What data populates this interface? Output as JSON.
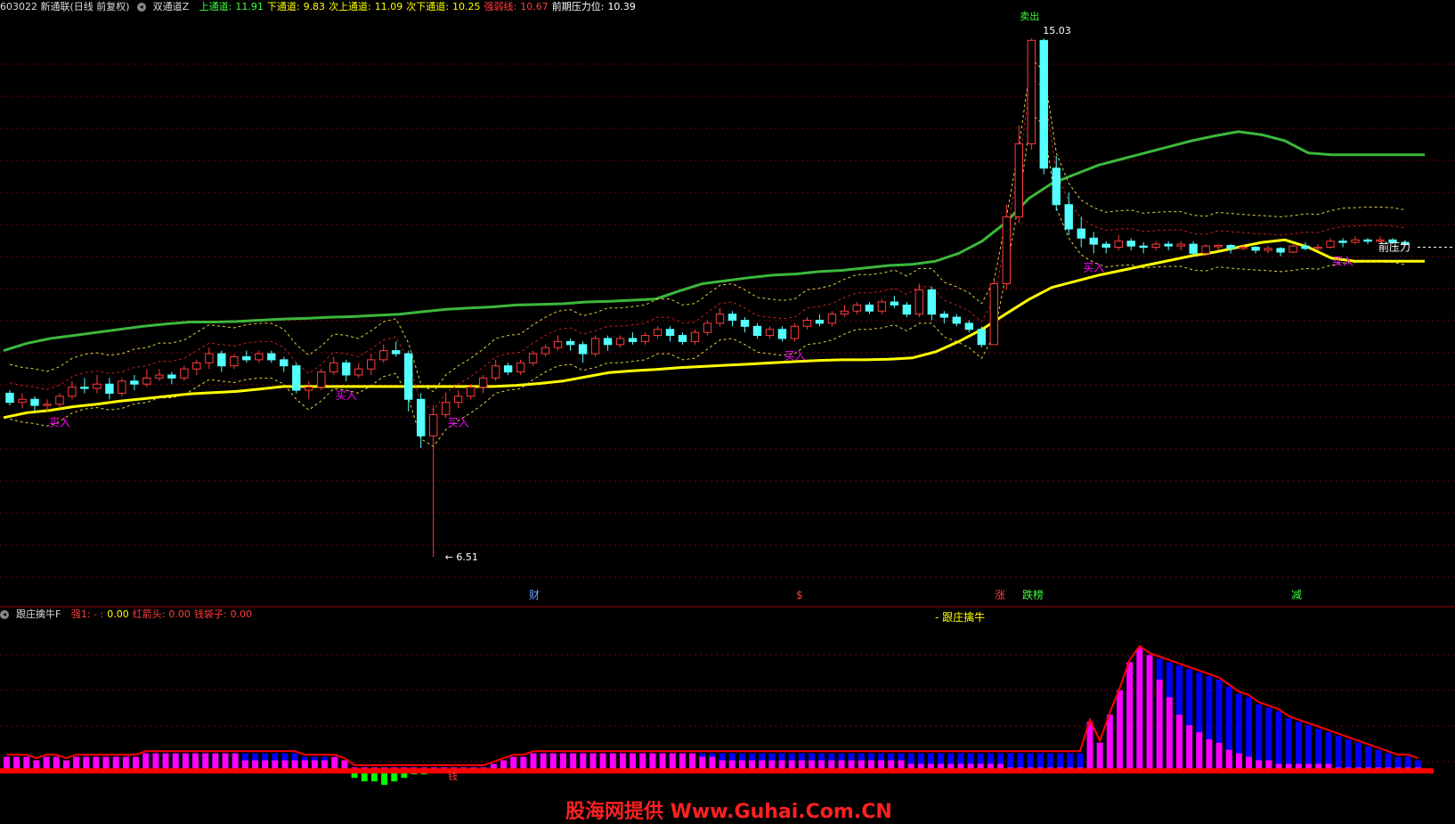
{
  "header": {
    "stock": "603022 新通联(日线 前复权)",
    "indicator": "双通道Z",
    "fields": [
      {
        "label": "上通道:",
        "value": "11.91",
        "color": "#3cff3c"
      },
      {
        "label": "下通道:",
        "value": "9.83",
        "color": "#ffff00"
      },
      {
        "label": "次上通道:",
        "value": "11.09",
        "color": "#ffff00"
      },
      {
        "label": "次下通道:",
        "value": "10.25",
        "color": "#ffff00"
      },
      {
        "label": "强弱线:",
        "value": "10.67",
        "color": "#ff3c3c"
      },
      {
        "label": "前期压力位:",
        "value": "10.39",
        "color": "#ffffff"
      }
    ]
  },
  "sub_header": {
    "indicator": "跟庄擒牛F",
    "fields": [
      {
        "label": "强1: - :",
        "value": "0.00",
        "label_color": "#ff3c3c",
        "value_color": "#ffff00"
      },
      {
        "label": "红箭头:",
        "value": "0.00",
        "label_color": "#ff3c3c",
        "value_color": "#ff3c3c"
      },
      {
        "label": "钱袋子:",
        "value": "0.00",
        "label_color": "#ff3c3c",
        "value_color": "#ff3c3c"
      }
    ]
  },
  "annotations": {
    "high_price": "15.03",
    "low_price": "6.51",
    "buy_label": "买入",
    "sell_label": "卖出",
    "pressure_label": "前压力",
    "sub_label": "跟庄擒牛",
    "money_label": "钱",
    "event_markers": [
      "财",
      "$",
      "涨",
      "跌榜",
      "减"
    ]
  },
  "watermark": "股海网提供 Www.Guhai.Com.CN",
  "colors": {
    "up": "#ff3c3c",
    "down": "#54ffff",
    "upper_channel": "#3cb83c",
    "lower_channel": "#ffff00",
    "strength": "#ff3c3c",
    "pressure": "#ffffff",
    "sub_magenta": "#ff00ff",
    "sub_blue": "#0000ff",
    "sub_red": "#ff0000",
    "sub_green": "#00ff00",
    "grid": "#800000",
    "buy_text": "#ff00ff"
  },
  "chart_data": {
    "type": "candlestick",
    "ylim": [
      6.0,
      15.4
    ],
    "candles": [
      [
        9.2,
        9.05,
        9.25,
        9.0
      ],
      [
        9.05,
        9.1,
        9.2,
        8.95
      ],
      [
        9.1,
        9.0,
        9.15,
        8.9
      ],
      [
        9.0,
        9.02,
        9.1,
        8.9
      ],
      [
        9.02,
        9.15,
        9.2,
        8.95
      ],
      [
        9.15,
        9.3,
        9.4,
        9.1
      ],
      [
        9.3,
        9.28,
        9.45,
        9.2
      ],
      [
        9.28,
        9.35,
        9.5,
        9.2
      ],
      [
        9.35,
        9.2,
        9.45,
        9.1
      ],
      [
        9.2,
        9.4,
        9.45,
        9.15
      ],
      [
        9.4,
        9.35,
        9.5,
        9.25
      ],
      [
        9.35,
        9.45,
        9.6,
        9.3
      ],
      [
        9.45,
        9.5,
        9.6,
        9.4
      ],
      [
        9.5,
        9.45,
        9.55,
        9.35
      ],
      [
        9.45,
        9.6,
        9.65,
        9.4
      ],
      [
        9.6,
        9.7,
        9.75,
        9.5
      ],
      [
        9.7,
        9.85,
        9.95,
        9.6
      ],
      [
        9.85,
        9.65,
        9.9,
        9.55
      ],
      [
        9.65,
        9.8,
        9.85,
        9.6
      ],
      [
        9.8,
        9.75,
        9.9,
        9.7
      ],
      [
        9.75,
        9.85,
        9.9,
        9.7
      ],
      [
        9.85,
        9.75,
        9.9,
        9.7
      ],
      [
        9.75,
        9.65,
        9.8,
        9.55
      ],
      [
        9.65,
        9.25,
        9.7,
        9.2
      ],
      [
        9.25,
        9.3,
        9.4,
        9.1
      ],
      [
        9.3,
        9.55,
        9.6,
        9.25
      ],
      [
        9.55,
        9.7,
        9.8,
        9.5
      ],
      [
        9.7,
        9.5,
        9.75,
        9.4
      ],
      [
        9.5,
        9.6,
        9.7,
        9.45
      ],
      [
        9.6,
        9.75,
        9.85,
        9.5
      ],
      [
        9.75,
        9.9,
        10.0,
        9.7
      ],
      [
        9.9,
        9.85,
        10.05,
        9.8
      ],
      [
        9.85,
        9.1,
        9.9,
        8.9
      ],
      [
        9.1,
        8.5,
        9.2,
        8.3
      ],
      [
        8.5,
        8.85,
        9.0,
        6.51
      ],
      [
        8.85,
        9.05,
        9.2,
        8.8
      ],
      [
        9.05,
        9.15,
        9.25,
        8.95
      ],
      [
        9.15,
        9.3,
        9.35,
        9.1
      ],
      [
        9.3,
        9.45,
        9.5,
        9.2
      ],
      [
        9.45,
        9.65,
        9.75,
        9.4
      ],
      [
        9.65,
        9.55,
        9.7,
        9.5
      ],
      [
        9.55,
        9.7,
        9.75,
        9.5
      ],
      [
        9.7,
        9.85,
        9.9,
        9.65
      ],
      [
        9.85,
        9.95,
        10.0,
        9.8
      ],
      [
        9.95,
        10.05,
        10.15,
        9.9
      ],
      [
        10.05,
        10.0,
        10.1,
        9.9
      ],
      [
        10.0,
        9.85,
        10.05,
        9.7
      ],
      [
        9.85,
        10.1,
        10.15,
        9.8
      ],
      [
        10.1,
        10.0,
        10.15,
        9.9
      ],
      [
        10.0,
        10.1,
        10.15,
        9.95
      ],
      [
        10.1,
        10.05,
        10.2,
        10.0
      ],
      [
        10.05,
        10.15,
        10.2,
        10.0
      ],
      [
        10.15,
        10.25,
        10.3,
        10.1
      ],
      [
        10.25,
        10.15,
        10.3,
        10.05
      ],
      [
        10.15,
        10.05,
        10.2,
        10.0
      ],
      [
        10.05,
        10.2,
        10.25,
        10.0
      ],
      [
        10.2,
        10.35,
        10.4,
        10.15
      ],
      [
        10.35,
        10.5,
        10.6,
        10.3
      ],
      [
        10.5,
        10.4,
        10.55,
        10.3
      ],
      [
        10.4,
        10.3,
        10.45,
        10.2
      ],
      [
        10.3,
        10.15,
        10.35,
        10.1
      ],
      [
        10.15,
        10.25,
        10.3,
        10.1
      ],
      [
        10.25,
        10.1,
        10.3,
        10.05
      ],
      [
        10.1,
        10.3,
        10.35,
        10.05
      ],
      [
        10.3,
        10.4,
        10.45,
        10.25
      ],
      [
        10.4,
        10.35,
        10.5,
        10.3
      ],
      [
        10.35,
        10.5,
        10.55,
        10.3
      ],
      [
        10.5,
        10.55,
        10.65,
        10.45
      ],
      [
        10.55,
        10.65,
        10.7,
        10.5
      ],
      [
        10.65,
        10.55,
        10.7,
        10.5
      ],
      [
        10.55,
        10.7,
        10.75,
        10.5
      ],
      [
        10.7,
        10.65,
        10.8,
        10.6
      ],
      [
        10.65,
        10.5,
        10.7,
        10.45
      ],
      [
        10.5,
        10.9,
        11.0,
        10.45
      ],
      [
        10.9,
        10.5,
        10.95,
        10.4
      ],
      [
        10.5,
        10.45,
        10.55,
        10.35
      ],
      [
        10.45,
        10.35,
        10.5,
        10.3
      ],
      [
        10.35,
        10.25,
        10.4,
        10.2
      ],
      [
        10.25,
        10.0,
        10.3,
        9.95
      ],
      [
        10.0,
        11.0,
        11.05,
        10.0
      ],
      [
        11.0,
        12.1,
        12.3,
        10.9
      ],
      [
        12.1,
        13.3,
        13.6,
        12.0
      ],
      [
        13.3,
        15.0,
        15.03,
        13.2
      ],
      [
        15.0,
        12.9,
        15.03,
        12.8
      ],
      [
        12.9,
        12.3,
        13.1,
        12.2
      ],
      [
        12.3,
        11.9,
        12.5,
        11.8
      ],
      [
        11.9,
        11.75,
        12.1,
        11.6
      ],
      [
        11.75,
        11.65,
        11.85,
        11.5
      ],
      [
        11.65,
        11.6,
        11.7,
        11.5
      ],
      [
        11.6,
        11.7,
        11.8,
        11.55
      ],
      [
        11.7,
        11.62,
        11.75,
        11.55
      ],
      [
        11.62,
        11.6,
        11.68,
        11.5
      ],
      [
        11.6,
        11.65,
        11.7,
        11.55
      ],
      [
        11.65,
        11.62,
        11.7,
        11.55
      ],
      [
        11.62,
        11.65,
        11.7,
        11.55
      ],
      [
        11.65,
        11.5,
        11.7,
        11.45
      ],
      [
        11.5,
        11.62,
        11.65,
        11.45
      ],
      [
        11.62,
        11.63,
        11.65,
        11.55
      ],
      [
        11.63,
        11.58,
        11.65,
        11.5
      ],
      [
        11.58,
        11.6,
        11.65,
        11.55
      ],
      [
        11.6,
        11.55,
        11.62,
        11.5
      ],
      [
        11.55,
        11.58,
        11.62,
        11.5
      ],
      [
        11.58,
        11.52,
        11.6,
        11.45
      ],
      [
        11.52,
        11.62,
        11.65,
        11.5
      ],
      [
        11.62,
        11.58,
        11.68,
        11.55
      ],
      [
        11.58,
        11.6,
        11.65,
        11.55
      ],
      [
        11.6,
        11.7,
        11.75,
        11.58
      ],
      [
        11.7,
        11.68,
        11.75,
        11.6
      ],
      [
        11.68,
        11.72,
        11.78,
        11.65
      ],
      [
        11.72,
        11.7,
        11.75,
        11.65
      ],
      [
        11.7,
        11.72,
        11.78,
        11.68
      ],
      [
        11.72,
        11.68,
        11.75,
        11.65
      ],
      [
        11.68,
        11.65,
        11.72,
        11.62
      ]
    ],
    "upper_channel": [
      9.9,
      10.02,
      10.1,
      10.15,
      10.2,
      10.25,
      10.3,
      10.34,
      10.37,
      10.37,
      10.38,
      10.4,
      10.42,
      10.43,
      10.45,
      10.46,
      10.48,
      10.5,
      10.54,
      10.58,
      10.6,
      10.62,
      10.65,
      10.66,
      10.67,
      10.7,
      10.71,
      10.73,
      10.75,
      10.88,
      11.0,
      11.05,
      11.1,
      11.14,
      11.16,
      11.2,
      11.22,
      11.26,
      11.3,
      11.32,
      11.37,
      11.5,
      11.7,
      12.0,
      12.4,
      12.65,
      12.8,
      12.95,
      13.05,
      13.15,
      13.25,
      13.35,
      13.43,
      13.5,
      13.45,
      13.35,
      13.15,
      13.12,
      13.12,
      13.12,
      13.12,
      13.12
    ],
    "lower_channel": [
      8.8,
      8.88,
      8.92,
      8.98,
      9.02,
      9.07,
      9.11,
      9.15,
      9.19,
      9.21,
      9.23,
      9.27,
      9.31,
      9.31,
      9.31,
      9.31,
      9.31,
      9.31,
      9.31,
      9.31,
      9.31,
      9.31,
      9.33,
      9.36,
      9.4,
      9.47,
      9.54,
      9.57,
      9.59,
      9.62,
      9.64,
      9.66,
      9.68,
      9.7,
      9.72,
      9.74,
      9.75,
      9.75,
      9.76,
      9.78,
      9.88,
      10.05,
      10.25,
      10.5,
      10.74,
      10.94,
      11.04,
      11.14,
      11.22,
      11.3,
      11.38,
      11.46,
      11.52,
      11.6,
      11.68,
      11.72,
      11.6,
      11.42,
      11.37,
      11.37,
      11.37,
      11.37
    ],
    "pressure_level": 11.6,
    "sub_chart": {
      "ylim": [
        -5,
        42
      ],
      "magenta": [
        4,
        4,
        4,
        3,
        4,
        4,
        3,
        4,
        4,
        4,
        4,
        4,
        4,
        4,
        5,
        5,
        5,
        5,
        5,
        5,
        5,
        5,
        5,
        5,
        3,
        3,
        3,
        3,
        3,
        3,
        3,
        3,
        3,
        4,
        3,
        1,
        1,
        1,
        1,
        1,
        1,
        1,
        1,
        1,
        1,
        1,
        1,
        1,
        1,
        2,
        3,
        4,
        4,
        5,
        5,
        5,
        5,
        5,
        5,
        5,
        5,
        5,
        5,
        5,
        5,
        5,
        5,
        5,
        5,
        5,
        4,
        4,
        3,
        3,
        3,
        3,
        3,
        3,
        3,
        3,
        3,
        3,
        3,
        3,
        3,
        3,
        3,
        3,
        3,
        3,
        3,
        2,
        2,
        2,
        2,
        2,
        2,
        2,
        2,
        2,
        2,
        1,
        1,
        1,
        1,
        1,
        1,
        1,
        1,
        14,
        8,
        16,
        23,
        31,
        35,
        33,
        26,
        21,
        16,
        13,
        11,
        9,
        8,
        6,
        5,
        4,
        3,
        3,
        2,
        2,
        2,
        2,
        2,
        2,
        1,
        1,
        1,
        1,
        1,
        1,
        1,
        1,
        1
      ],
      "blue": [
        4,
        4,
        4,
        3,
        4,
        4,
        3,
        4,
        4,
        4,
        4,
        4,
        4,
        4,
        5,
        5,
        5,
        5,
        5,
        5,
        5,
        5,
        5,
        5,
        5,
        5,
        5,
        5,
        5,
        5,
        4,
        4,
        4,
        4,
        3,
        1,
        1,
        1,
        1,
        1,
        1,
        1,
        1,
        1,
        1,
        1,
        1,
        1,
        1,
        2,
        3,
        4,
        4,
        5,
        5,
        5,
        5,
        5,
        5,
        5,
        5,
        5,
        5,
        5,
        5,
        5,
        5,
        5,
        5,
        5,
        5,
        5,
        5,
        5,
        5,
        5,
        5,
        5,
        5,
        5,
        5,
        5,
        5,
        5,
        5,
        5,
        5,
        5,
        5,
        5,
        5,
        5,
        5,
        5,
        5,
        5,
        5,
        5,
        5,
        5,
        5,
        5,
        5,
        5,
        5,
        5,
        5,
        5,
        5,
        14,
        8,
        16,
        23,
        31,
        35,
        33,
        32,
        31,
        30,
        29,
        28,
        27,
        26,
        24,
        22,
        21,
        19,
        18,
        17,
        15,
        14,
        13,
        12,
        11,
        10,
        9,
        8,
        7,
        6,
        5,
        4,
        4,
        3
      ],
      "green": [
        0,
        0,
        0,
        0,
        0,
        0,
        0,
        0,
        0,
        0,
        0,
        0,
        0,
        0,
        0,
        0,
        0,
        0,
        0,
        0,
        0,
        0,
        0,
        0,
        0,
        0,
        0,
        0,
        0,
        0,
        0,
        0,
        0,
        0,
        0,
        -2,
        -3,
        -3,
        -4,
        -3,
        -2,
        -1,
        -1,
        0,
        0,
        0,
        0,
        0,
        0,
        0,
        0,
        0,
        0,
        0,
        0,
        0,
        0,
        0,
        0,
        0,
        0,
        0,
        0,
        0,
        0,
        0,
        0,
        0,
        0,
        0,
        0,
        0,
        0,
        0,
        0,
        0,
        0,
        0,
        0,
        0,
        0,
        0,
        0,
        0,
        0,
        0,
        0,
        0,
        0,
        0,
        0,
        0,
        0,
        0,
        0,
        0,
        0,
        0,
        0,
        0,
        0,
        0,
        0,
        0,
        0,
        0,
        0,
        0,
        0,
        0,
        0,
        0,
        0,
        0,
        0,
        0,
        0,
        0,
        0,
        0,
        0,
        0,
        0,
        0,
        0,
        0,
        0,
        0,
        0,
        0,
        0,
        0,
        0,
        0,
        0,
        0,
        0,
        0,
        0,
        0,
        0,
        0,
        0
      ]
    }
  }
}
